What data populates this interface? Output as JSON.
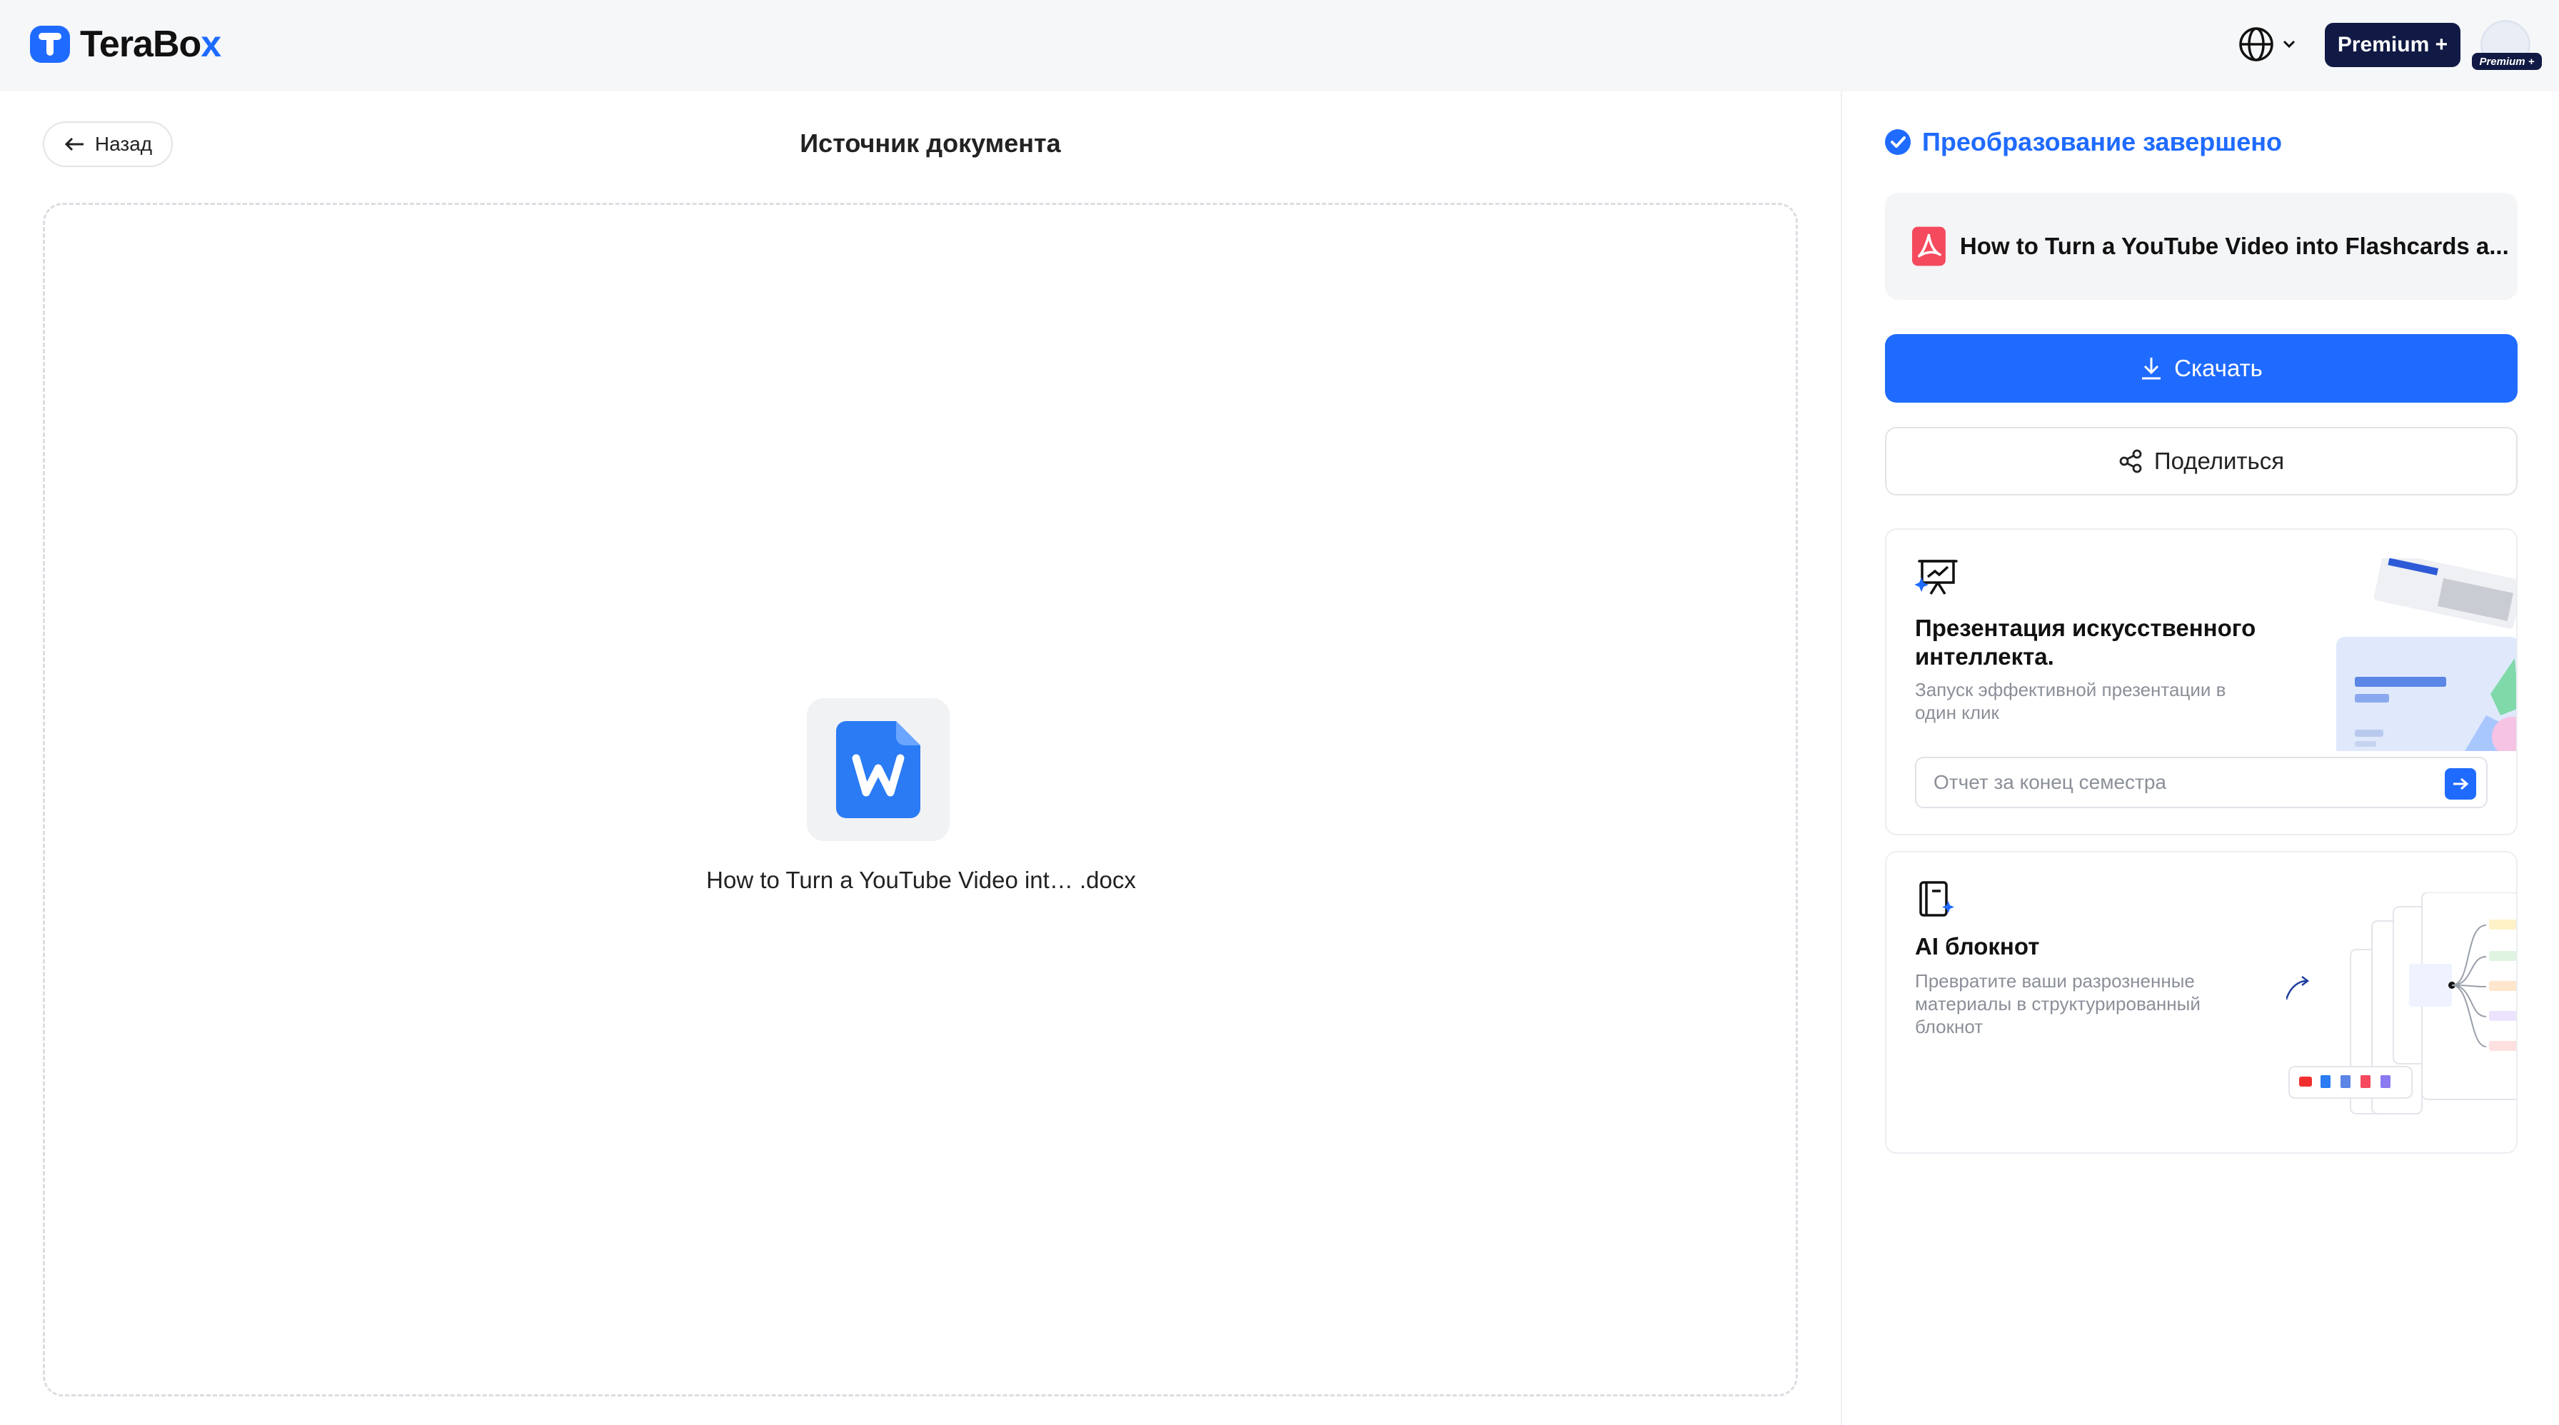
{
  "app": {
    "brand_name": "TeraBox",
    "brand_color": "#1f6bff"
  },
  "header": {
    "premium_label": "Premium +",
    "avatar_badge": "Premium +"
  },
  "left": {
    "back_label": "Назад",
    "title": "Источник документа",
    "file_name": "How to Turn a YouTube Video int… .docx"
  },
  "right": {
    "status": "Преобразование завершено",
    "result_file_name": "How to Turn a YouTube Video into Flashcards a...",
    "download_label": "Скачать",
    "share_label": "Поделиться",
    "presentation_card": {
      "title": "Презентация искусственного интеллекта.",
      "description": "Запуск эффективной презентации в один клик",
      "input_placeholder": "Отчет за конец семестра"
    },
    "notebook_card": {
      "title": "AI блокнот",
      "description": "Превратите ваши разрозненные материалы в структурированный блокнот"
    }
  }
}
